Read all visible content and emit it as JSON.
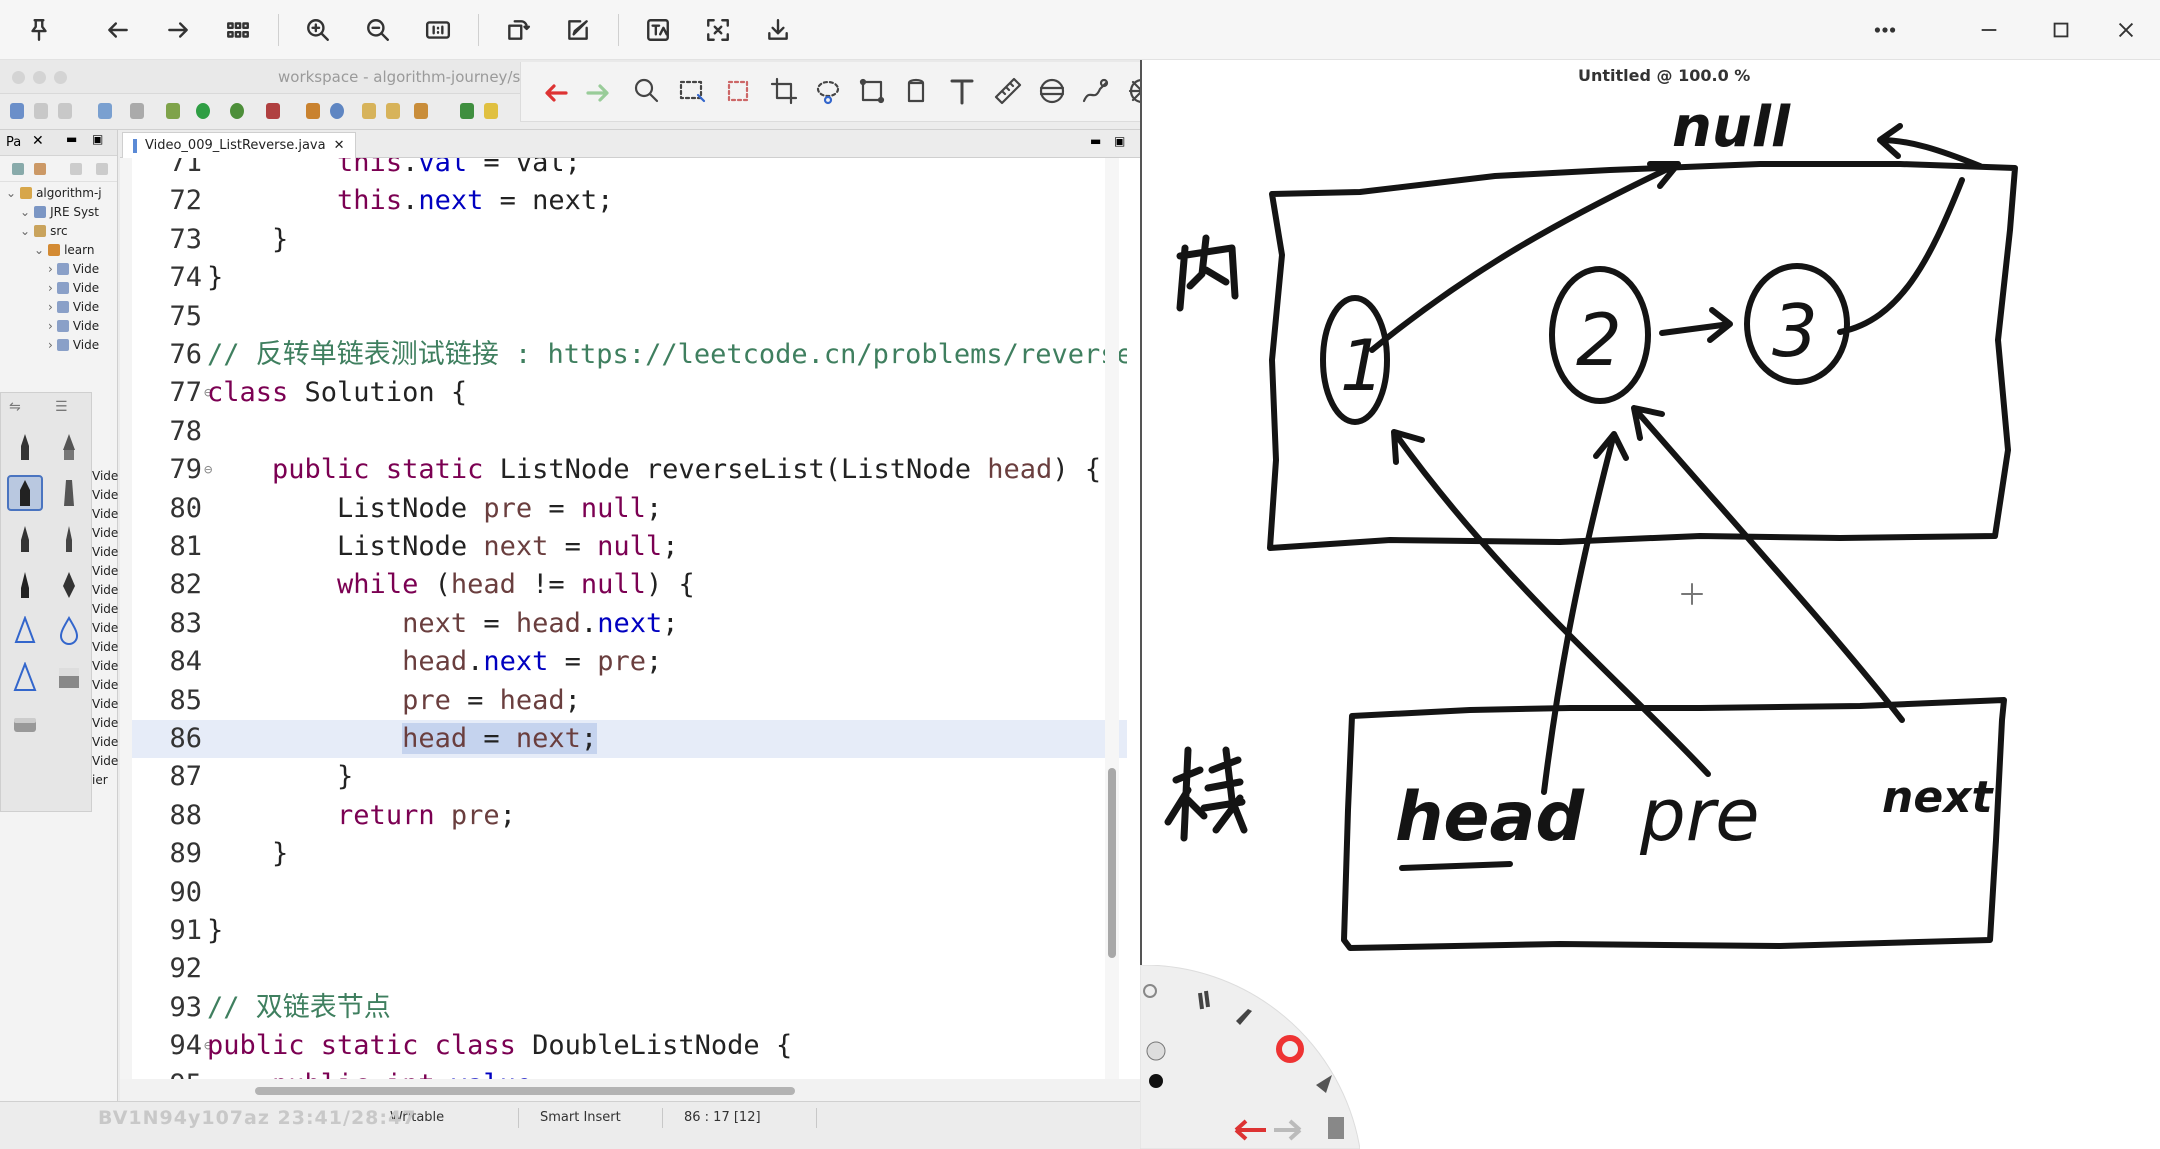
{
  "viewer_toolbar": {
    "buttons": [
      "pin-icon",
      "back-icon",
      "forward-icon",
      "grid-icon",
      "zoom-in-icon",
      "zoom-out-icon",
      "actual-size-icon",
      "rotate-icon",
      "edit-icon",
      "translate-icon",
      "crop-screen-icon",
      "download-icon"
    ],
    "more_icon": "more-icon"
  },
  "eclipse": {
    "window_title": "workspace - algorithm-journey/s",
    "package_explorer_tab": "Pa",
    "tree": [
      {
        "label": "algorithm-j",
        "indent": 0
      },
      {
        "label": "JRE Syst",
        "indent": 1
      },
      {
        "label": "src",
        "indent": 1
      },
      {
        "label": "learn",
        "indent": 2
      },
      {
        "label": "Vide",
        "indent": 3
      },
      {
        "label": "Vide",
        "indent": 3
      },
      {
        "label": "Vide",
        "indent": 3
      },
      {
        "label": "Vide",
        "indent": 3
      },
      {
        "label": "Vide",
        "indent": 3
      }
    ],
    "tree_lower": [
      "Vide",
      "Vide",
      "Vide",
      "Vide",
      "Vide",
      "Vide",
      "Vide",
      "Vide",
      "Vide",
      "Vide",
      "Vide",
      "Vide",
      "Vide",
      "Vide",
      "Vide",
      "Vide",
      "ier"
    ],
    "editor_tab": "Video_009_ListReverse.java",
    "code_lines": [
      {
        "n": "71",
        "tokens": [
          {
            "t": "        "
          },
          {
            "t": "this",
            "c": "kw"
          },
          {
            "t": "."
          },
          {
            "t": "val",
            "c": "fld"
          },
          {
            "t": " = val;"
          }
        ]
      },
      {
        "n": "72",
        "tokens": [
          {
            "t": "        "
          },
          {
            "t": "this",
            "c": "kw"
          },
          {
            "t": "."
          },
          {
            "t": "next",
            "c": "fld"
          },
          {
            "t": " = next;"
          }
        ]
      },
      {
        "n": "73",
        "tokens": [
          {
            "t": "    }"
          }
        ]
      },
      {
        "n": "74",
        "tokens": [
          {
            "t": "}"
          }
        ]
      },
      {
        "n": "75",
        "tokens": []
      },
      {
        "n": "76",
        "tokens": [
          {
            "t": "// 反转单链表测试链接 : https://leetcode.cn/problems/reverse",
            "c": "cm"
          }
        ]
      },
      {
        "n": "77",
        "fold": true,
        "tokens": [
          {
            "t": "class",
            "c": "kw"
          },
          {
            "t": " Solution {"
          }
        ]
      },
      {
        "n": "78",
        "tokens": []
      },
      {
        "n": "79",
        "fold": true,
        "tokens": [
          {
            "t": "    "
          },
          {
            "t": "public static",
            "c": "kw"
          },
          {
            "t": " ListNode reverseList(ListNode "
          },
          {
            "t": "head",
            "c": "var"
          },
          {
            "t": ") {"
          }
        ]
      },
      {
        "n": "80",
        "tokens": [
          {
            "t": "        ListNode "
          },
          {
            "t": "pre",
            "c": "var"
          },
          {
            "t": " = "
          },
          {
            "t": "null",
            "c": "kw"
          },
          {
            "t": ";"
          }
        ]
      },
      {
        "n": "81",
        "tokens": [
          {
            "t": "        ListNode "
          },
          {
            "t": "next",
            "c": "var"
          },
          {
            "t": " = "
          },
          {
            "t": "null",
            "c": "kw"
          },
          {
            "t": ";"
          }
        ]
      },
      {
        "n": "82",
        "tokens": [
          {
            "t": "        "
          },
          {
            "t": "while",
            "c": "kw"
          },
          {
            "t": " ("
          },
          {
            "t": "head",
            "c": "var"
          },
          {
            "t": " != "
          },
          {
            "t": "null",
            "c": "kw"
          },
          {
            "t": ") {"
          }
        ]
      },
      {
        "n": "83",
        "tokens": [
          {
            "t": "            "
          },
          {
            "t": "next",
            "c": "var"
          },
          {
            "t": " = "
          },
          {
            "t": "head",
            "c": "var"
          },
          {
            "t": "."
          },
          {
            "t": "next",
            "c": "fld"
          },
          {
            "t": ";"
          }
        ]
      },
      {
        "n": "84",
        "tokens": [
          {
            "t": "            "
          },
          {
            "t": "head",
            "c": "var"
          },
          {
            "t": "."
          },
          {
            "t": "next",
            "c": "fld"
          },
          {
            "t": " = "
          },
          {
            "t": "pre",
            "c": "var"
          },
          {
            "t": ";"
          }
        ]
      },
      {
        "n": "85",
        "tokens": [
          {
            "t": "            "
          },
          {
            "t": "pre",
            "c": "var"
          },
          {
            "t": " = "
          },
          {
            "t": "head",
            "c": "var"
          },
          {
            "t": ";"
          }
        ]
      },
      {
        "n": "86",
        "current": true,
        "tokens": [
          {
            "t": "            "
          },
          {
            "t": "head",
            "c": "var",
            "sel": true
          },
          {
            "t": " = ",
            "sel": true
          },
          {
            "t": "next",
            "c": "var",
            "sel": true
          },
          {
            "t": ";",
            "sel": true
          }
        ]
      },
      {
        "n": "87",
        "tokens": [
          {
            "t": "        }"
          }
        ]
      },
      {
        "n": "88",
        "tokens": [
          {
            "t": "        "
          },
          {
            "t": "return",
            "c": "kw"
          },
          {
            "t": " "
          },
          {
            "t": "pre",
            "c": "var"
          },
          {
            "t": ";"
          }
        ]
      },
      {
        "n": "89",
        "tokens": [
          {
            "t": "    }"
          }
        ]
      },
      {
        "n": "90",
        "tokens": []
      },
      {
        "n": "91",
        "tokens": [
          {
            "t": "}"
          }
        ]
      },
      {
        "n": "92",
        "tokens": []
      },
      {
        "n": "93",
        "tokens": [
          {
            "t": "// 双链表节点",
            "c": "cm"
          }
        ]
      },
      {
        "n": "94",
        "fold": true,
        "tokens": [
          {
            "t": "public static class",
            "c": "kw"
          },
          {
            "t": " DoubleListNode {"
          }
        ]
      },
      {
        "n": "95",
        "tokens": [
          {
            "t": "    "
          },
          {
            "t": "public int",
            "c": "kw"
          },
          {
            "t": " "
          },
          {
            "t": "value",
            "c": "fld"
          },
          {
            "t": ";"
          }
        ]
      }
    ],
    "status": {
      "writable": "Writable",
      "insert_mode": "Smart Insert",
      "position": "86 : 17 [12]"
    }
  },
  "drawing_app": {
    "title": "Untitled @ 100.0 %",
    "tools": [
      "undo-icon",
      "redo-icon",
      "magnify-icon",
      "rect-select-icon",
      "magic-select-icon",
      "crop-icon",
      "lasso-icon",
      "transform-icon",
      "bucket-icon",
      "text-icon",
      "ruler-icon",
      "grid-guide-icon",
      "pen-curve-icon",
      "perspective-icon",
      "symmetry-icon",
      "stroke-icon",
      "ellipse-icon",
      "shape-icon",
      "layers-icon",
      "brush-lib-icon",
      "color-wheel-icon",
      "panels-icon"
    ],
    "ink_labels": {
      "null": "null",
      "heap": "内",
      "stack": "栈",
      "node1": "1",
      "node2": "2",
      "node3": "3",
      "var_head": "head",
      "var_pre": "pre",
      "var_next": "next"
    }
  },
  "watermark": "BV1N94y107az 23:41/28:47",
  "colors": {
    "keyword": "#7b0052",
    "field": "#0000c0",
    "comment": "#3f7f5f",
    "selection": "#c5d3ee",
    "current_line": "#e6ecf8"
  }
}
